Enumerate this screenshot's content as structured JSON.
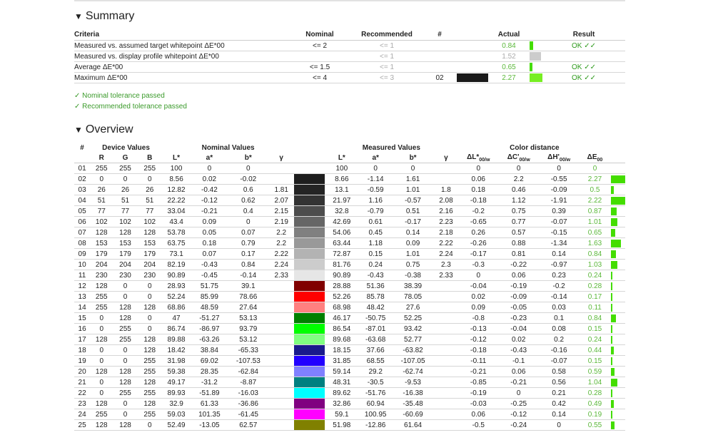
{
  "summary": {
    "title": "Summary",
    "headers": {
      "criteria": "Criteria",
      "nominal": "Nominal",
      "recommended": "Recommended",
      "num": "#",
      "actual": "Actual",
      "result": "Result"
    },
    "rows": [
      {
        "criteria": "Measured vs. assumed target whitepoint ΔE*00",
        "nominal": "<= 2",
        "recommended": "<= 1",
        "num": "",
        "swatch": "",
        "actual": "0.84",
        "bar_fraction": 0.28,
        "bar_color": "#44dd00",
        "result": "OK ✓✓"
      },
      {
        "criteria": "Measured vs. display profile whitepoint ΔE*00",
        "nominal": "",
        "recommended": "<= 1",
        "num": "",
        "swatch": "",
        "actual": "1.52",
        "bar_fraction": 0.9,
        "bar_color": "#cccccc",
        "result": ""
      },
      {
        "criteria": "Average ΔE*00",
        "nominal": "<= 1.5",
        "recommended": "<= 1",
        "num": "",
        "swatch": "",
        "actual": "0.65",
        "bar_fraction": 0.22,
        "bar_color": "#44dd00",
        "result": "OK ✓✓"
      },
      {
        "criteria": "Maximum ΔE*00",
        "nominal": "<= 4",
        "recommended": "<= 3",
        "num": "02",
        "swatch": "#1a1a1a",
        "actual": "2.27",
        "bar_fraction": 1.0,
        "bar_color": "#77ee22",
        "result": "OK ✓✓"
      }
    ],
    "passed": [
      "✓ Nominal tolerance passed",
      "✓ Recommended tolerance passed"
    ]
  },
  "overview": {
    "title": "Overview",
    "group_headers": {
      "num": "#",
      "device": "Device Values",
      "nominal": "Nominal Values",
      "measured": "Measured Values",
      "distance": "Color distance"
    },
    "col_headers": {
      "R": "R",
      "G": "G",
      "B": "B",
      "L": "L*",
      "a": "a*",
      "b": "b*",
      "gamma": "γ",
      "mL": "L*",
      "ma": "a*",
      "mb": "b*",
      "mgamma": "γ",
      "dL": "ΔL*",
      "dC": "ΔC'",
      "dH": "ΔH'",
      "dE": "ΔE",
      "sub_w": "00/w",
      "sub_00": "00"
    },
    "rows": [
      {
        "n": "01",
        "R": "255",
        "G": "255",
        "B": "255",
        "L": "100",
        "a": "0",
        "b": "0",
        "g": "",
        "sw": "#ffffff",
        "mL": "100",
        "ma": "0",
        "mb": "0",
        "mg": "",
        "dL": "0",
        "dC": "0",
        "dH": "0",
        "dE": "0",
        "e": 0
      },
      {
        "n": "02",
        "R": "0",
        "G": "0",
        "B": "0",
        "L": "8.56",
        "a": "0.02",
        "b": "-0.02",
        "g": "",
        "sw": "#1e1e1e",
        "mL": "8.66",
        "ma": "-1.14",
        "mb": "1.61",
        "mg": "",
        "dL": "0.06",
        "dC": "2.2",
        "dH": "-0.55",
        "dE": "2.27",
        "e": 2.27
      },
      {
        "n": "03",
        "R": "26",
        "G": "26",
        "B": "26",
        "L": "12.82",
        "a": "-0.42",
        "b": "0.6",
        "g": "1.81",
        "sw": "#242424",
        "mL": "13.1",
        "ma": "-0.59",
        "mb": "1.01",
        "mg": "1.8",
        "dL": "0.18",
        "dC": "0.46",
        "dH": "-0.09",
        "dE": "0.5",
        "e": 0.5
      },
      {
        "n": "04",
        "R": "51",
        "G": "51",
        "B": "51",
        "L": "22.22",
        "a": "-0.12",
        "b": "0.62",
        "g": "2.07",
        "sw": "#333333",
        "mL": "21.97",
        "ma": "1.16",
        "mb": "-0.57",
        "mg": "2.08",
        "dL": "-0.18",
        "dC": "1.12",
        "dH": "-1.91",
        "dE": "2.22",
        "e": 2.22
      },
      {
        "n": "05",
        "R": "77",
        "G": "77",
        "B": "77",
        "L": "33.04",
        "a": "-0.21",
        "b": "0.4",
        "g": "2.15",
        "sw": "#4d4d4d",
        "mL": "32.8",
        "ma": "-0.79",
        "mb": "0.51",
        "mg": "2.16",
        "dL": "-0.2",
        "dC": "0.75",
        "dH": "0.39",
        "dE": "0.87",
        "e": 0.87
      },
      {
        "n": "06",
        "R": "102",
        "G": "102",
        "B": "102",
        "L": "43.4",
        "a": "0.09",
        "b": "0",
        "g": "2.19",
        "sw": "#666666",
        "mL": "42.69",
        "ma": "0.61",
        "mb": "-0.17",
        "mg": "2.23",
        "dL": "-0.65",
        "dC": "0.77",
        "dH": "-0.07",
        "dE": "1.01",
        "e": 1.01
      },
      {
        "n": "07",
        "R": "128",
        "G": "128",
        "B": "128",
        "L": "53.78",
        "a": "0.05",
        "b": "0.07",
        "g": "2.2",
        "sw": "#808080",
        "mL": "54.06",
        "ma": "0.45",
        "mb": "0.14",
        "mg": "2.18",
        "dL": "0.26",
        "dC": "0.57",
        "dH": "-0.15",
        "dE": "0.65",
        "e": 0.65
      },
      {
        "n": "08",
        "R": "153",
        "G": "153",
        "B": "153",
        "L": "63.75",
        "a": "0.18",
        "b": "0.79",
        "g": "2.2",
        "sw": "#999999",
        "mL": "63.44",
        "ma": "1.18",
        "mb": "0.09",
        "mg": "2.22",
        "dL": "-0.26",
        "dC": "0.88",
        "dH": "-1.34",
        "dE": "1.63",
        "e": 1.63
      },
      {
        "n": "09",
        "R": "179",
        "G": "179",
        "B": "179",
        "L": "73.1",
        "a": "0.07",
        "b": "0.17",
        "g": "2.22",
        "sw": "#b3b3b3",
        "mL": "72.87",
        "ma": "0.15",
        "mb": "1.01",
        "mg": "2.24",
        "dL": "-0.17",
        "dC": "0.81",
        "dH": "0.14",
        "dE": "0.84",
        "e": 0.84
      },
      {
        "n": "10",
        "R": "204",
        "G": "204",
        "B": "204",
        "L": "82.19",
        "a": "-0.43",
        "b": "0.84",
        "g": "2.24",
        "sw": "#cccccc",
        "mL": "81.76",
        "ma": "0.24",
        "mb": "0.75",
        "mg": "2.3",
        "dL": "-0.3",
        "dC": "-0.22",
        "dH": "-0.97",
        "dE": "1.03",
        "e": 1.03
      },
      {
        "n": "11",
        "R": "230",
        "G": "230",
        "B": "230",
        "L": "90.89",
        "a": "-0.45",
        "b": "-0.14",
        "g": "2.33",
        "sw": "#e6e6e6",
        "mL": "90.89",
        "ma": "-0.43",
        "mb": "-0.38",
        "mg": "2.33",
        "dL": "0",
        "dC": "0.06",
        "dH": "0.23",
        "dE": "0.24",
        "e": 0.24
      },
      {
        "n": "12",
        "R": "128",
        "G": "0",
        "B": "0",
        "L": "28.93",
        "a": "51.75",
        "b": "39.1",
        "g": "",
        "sw": "#800000",
        "mL": "28.88",
        "ma": "51.36",
        "mb": "38.39",
        "mg": "",
        "dL": "-0.04",
        "dC": "-0.19",
        "dH": "-0.2",
        "dE": "0.28",
        "e": 0.28
      },
      {
        "n": "13",
        "R": "255",
        "G": "0",
        "B": "0",
        "L": "52.24",
        "a": "85.99",
        "b": "78.66",
        "g": "",
        "sw": "#ff0000",
        "mL": "52.26",
        "ma": "85.78",
        "mb": "78.05",
        "mg": "",
        "dL": "0.02",
        "dC": "-0.09",
        "dH": "-0.14",
        "dE": "0.17",
        "e": 0.17
      },
      {
        "n": "14",
        "R": "255",
        "G": "128",
        "B": "128",
        "L": "68.86",
        "a": "48.59",
        "b": "27.64",
        "g": "",
        "sw": "#ff8080",
        "mL": "68.98",
        "ma": "48.42",
        "mb": "27.6",
        "mg": "",
        "dL": "0.09",
        "dC": "-0.05",
        "dH": "0.03",
        "dE": "0.11",
        "e": 0.11
      },
      {
        "n": "15",
        "R": "0",
        "G": "128",
        "B": "0",
        "L": "47",
        "a": "-51.27",
        "b": "53.13",
        "g": "",
        "sw": "#008000",
        "mL": "46.17",
        "ma": "-50.75",
        "mb": "52.25",
        "mg": "",
        "dL": "-0.8",
        "dC": "-0.23",
        "dH": "0.1",
        "dE": "0.84",
        "e": 0.84
      },
      {
        "n": "16",
        "R": "0",
        "G": "255",
        "B": "0",
        "L": "86.74",
        "a": "-86.97",
        "b": "93.79",
        "g": "",
        "sw": "#00ff00",
        "mL": "86.54",
        "ma": "-87.01",
        "mb": "93.42",
        "mg": "",
        "dL": "-0.13",
        "dC": "-0.04",
        "dH": "0.08",
        "dE": "0.15",
        "e": 0.15
      },
      {
        "n": "17",
        "R": "128",
        "G": "255",
        "B": "128",
        "L": "89.88",
        "a": "-63.26",
        "b": "53.12",
        "g": "",
        "sw": "#80ff80",
        "mL": "89.68",
        "ma": "-63.68",
        "mb": "52.77",
        "mg": "",
        "dL": "-0.12",
        "dC": "0.02",
        "dH": "0.2",
        "dE": "0.24",
        "e": 0.24
      },
      {
        "n": "18",
        "R": "0",
        "G": "0",
        "B": "128",
        "L": "18.42",
        "a": "38.84",
        "b": "-65.33",
        "g": "",
        "sw": "#1a1a8c",
        "mL": "18.15",
        "ma": "37.66",
        "mb": "-63.82",
        "mg": "",
        "dL": "-0.18",
        "dC": "-0.43",
        "dH": "-0.16",
        "dE": "0.44",
        "e": 0.44
      },
      {
        "n": "19",
        "R": "0",
        "G": "0",
        "B": "255",
        "L": "31.98",
        "a": "69.02",
        "b": "-107.53",
        "g": "",
        "sw": "#2200ff",
        "mL": "31.85",
        "ma": "68.55",
        "mb": "-107.05",
        "mg": "",
        "dL": "-0.11",
        "dC": "-0.1",
        "dH": "-0.07",
        "dE": "0.15",
        "e": 0.15
      },
      {
        "n": "20",
        "R": "128",
        "G": "128",
        "B": "255",
        "L": "59.38",
        "a": "28.35",
        "b": "-62.84",
        "g": "",
        "sw": "#8080ff",
        "mL": "59.14",
        "ma": "29.2",
        "mb": "-62.74",
        "mg": "",
        "dL": "-0.21",
        "dC": "0.06",
        "dH": "0.58",
        "dE": "0.59",
        "e": 0.59
      },
      {
        "n": "21",
        "R": "0",
        "G": "128",
        "B": "128",
        "L": "49.17",
        "a": "-31.2",
        "b": "-8.87",
        "g": "",
        "sw": "#008080",
        "mL": "48.31",
        "ma": "-30.5",
        "mb": "-9.53",
        "mg": "",
        "dL": "-0.85",
        "dC": "-0.21",
        "dH": "0.56",
        "dE": "1.04",
        "e": 1.04
      },
      {
        "n": "22",
        "R": "0",
        "G": "255",
        "B": "255",
        "L": "89.93",
        "a": "-51.89",
        "b": "-16.03",
        "g": "",
        "sw": "#00ffff",
        "mL": "89.62",
        "ma": "-51.76",
        "mb": "-16.38",
        "mg": "",
        "dL": "-0.19",
        "dC": "0",
        "dH": "0.21",
        "dE": "0.28",
        "e": 0.28
      },
      {
        "n": "23",
        "R": "128",
        "G": "0",
        "B": "128",
        "L": "32.9",
        "a": "61.33",
        "b": "-36.86",
        "g": "",
        "sw": "#800080",
        "mL": "32.86",
        "ma": "60.94",
        "mb": "-35.48",
        "mg": "",
        "dL": "-0.03",
        "dC": "-0.25",
        "dH": "0.42",
        "dE": "0.49",
        "e": 0.49
      },
      {
        "n": "24",
        "R": "255",
        "G": "0",
        "B": "255",
        "L": "59.03",
        "a": "101.35",
        "b": "-61.45",
        "g": "",
        "sw": "#ff00ff",
        "mL": "59.1",
        "ma": "100.95",
        "mb": "-60.69",
        "mg": "",
        "dL": "0.06",
        "dC": "-0.12",
        "dH": "0.14",
        "dE": "0.19",
        "e": 0.19
      },
      {
        "n": "25",
        "R": "128",
        "G": "128",
        "B": "0",
        "L": "52.49",
        "a": "-13.05",
        "b": "62.57",
        "g": "",
        "sw": "#808000",
        "mL": "51.98",
        "ma": "-12.86",
        "mb": "61.64",
        "mg": "",
        "dL": "-0.5",
        "dC": "-0.24",
        "dH": "0",
        "dE": "0.55",
        "e": 0.55
      }
    ]
  }
}
